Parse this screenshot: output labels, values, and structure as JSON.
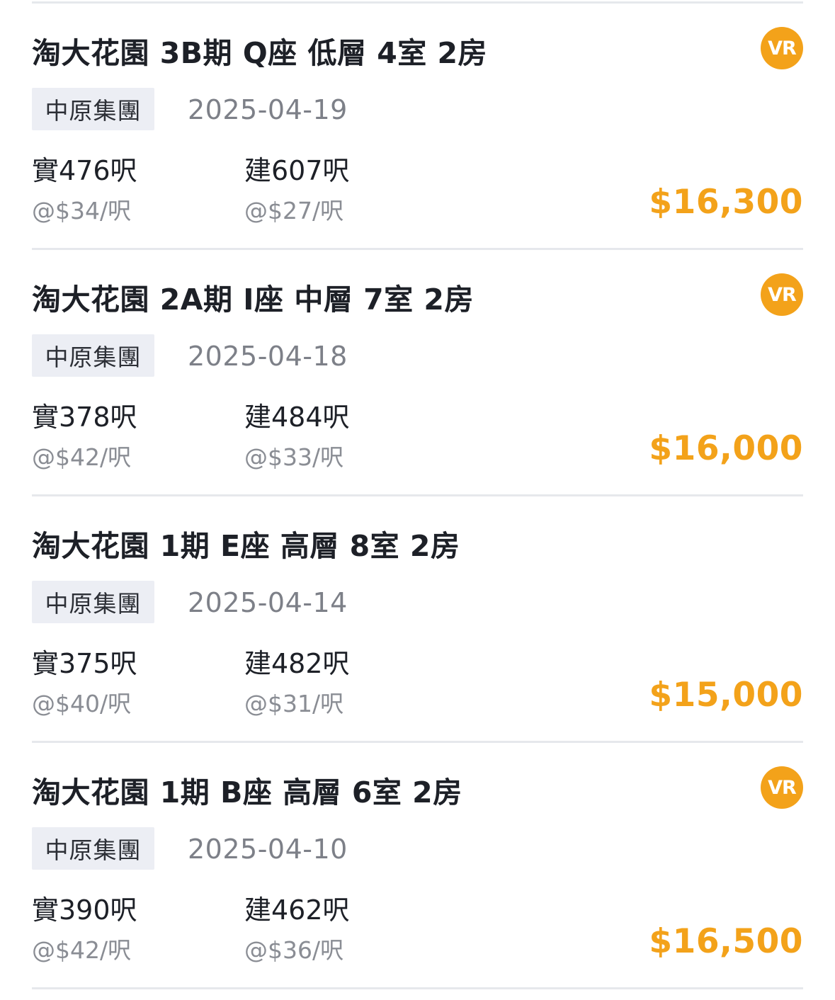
{
  "colors": {
    "accent": "#f3a21a",
    "title_text": "#1d2027",
    "tag_background": "#eceef4",
    "secondary_text": "#7d8088",
    "divider": "#e6e8ec"
  },
  "listings": [
    {
      "title": "淘大花園 3B期 Q座 低層 4室 2房",
      "has_vr": true,
      "vr_label": "VR",
      "agency": "中原集團",
      "date": "2025-04-19",
      "net_area": "實476呎",
      "net_unit_price": "@$34/呎",
      "gross_area": "建607呎",
      "gross_unit_price": "@$27/呎",
      "price": "$16,300"
    },
    {
      "title": "淘大花園 2A期 I座 中層 7室 2房",
      "has_vr": true,
      "vr_label": "VR",
      "agency": "中原集團",
      "date": "2025-04-18",
      "net_area": "實378呎",
      "net_unit_price": "@$42/呎",
      "gross_area": "建484呎",
      "gross_unit_price": "@$33/呎",
      "price": "$16,000"
    },
    {
      "title": "淘大花園 1期 E座 高層 8室 2房",
      "has_vr": false,
      "vr_label": "",
      "agency": "中原集團",
      "date": "2025-04-14",
      "net_area": "實375呎",
      "net_unit_price": "@$40/呎",
      "gross_area": "建482呎",
      "gross_unit_price": "@$31/呎",
      "price": "$15,000"
    },
    {
      "title": "淘大花園 1期 B座 高層 6室 2房",
      "has_vr": true,
      "vr_label": "VR",
      "agency": "中原集團",
      "date": "2025-04-10",
      "net_area": "實390呎",
      "net_unit_price": "@$42/呎",
      "gross_area": "建462呎",
      "gross_unit_price": "@$36/呎",
      "price": "$16,500"
    }
  ]
}
